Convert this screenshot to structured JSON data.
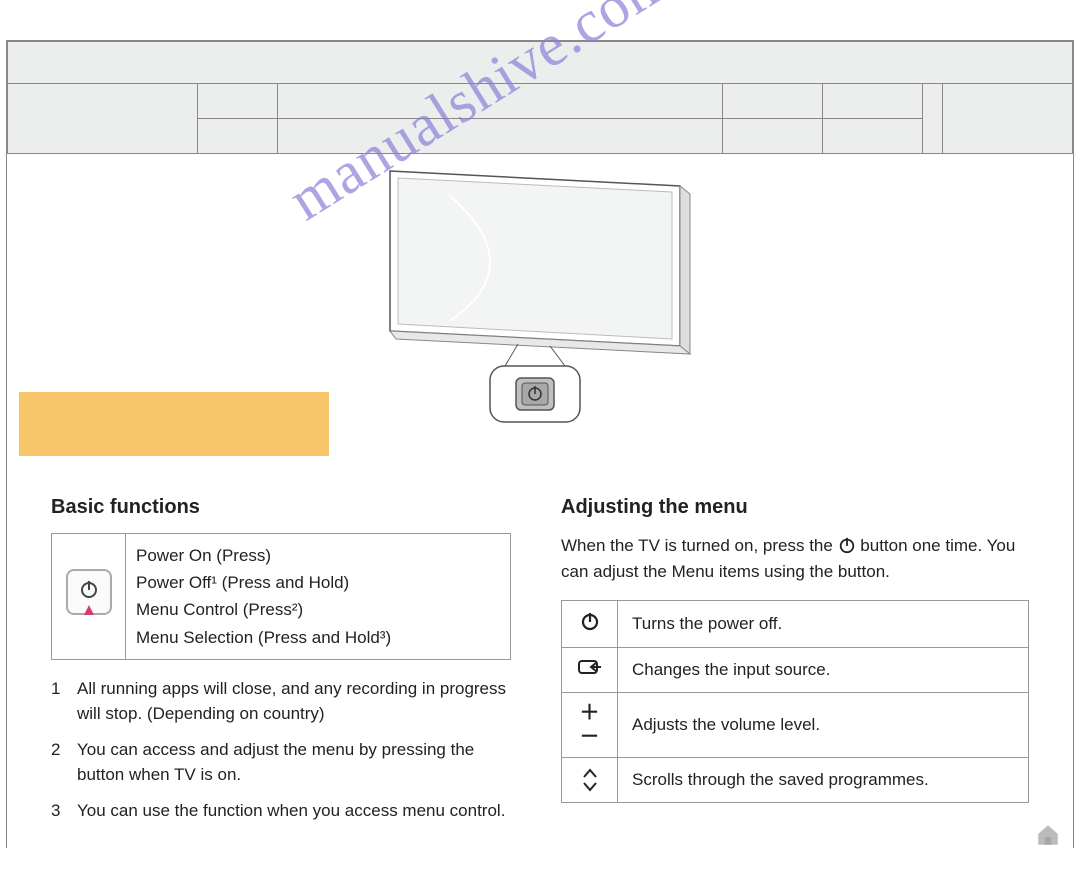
{
  "watermark": "manualshive.com",
  "basic_functions": {
    "heading": "Basic functions",
    "lines": [
      "Power On (Press)",
      "Power Off¹ (Press and Hold)",
      "Menu Control (Press²)",
      "Menu Selection (Press and Hold³)"
    ],
    "notes": [
      {
        "n": "1",
        "text": "All running apps will close, and any recording in progress will stop. (Depending on country)"
      },
      {
        "n": "2",
        "text": "You can access and adjust the menu by pressing the button when TV is on."
      },
      {
        "n": "3",
        "text": "You can use the function when you access menu control."
      }
    ]
  },
  "adjusting_menu": {
    "heading": "Adjusting the menu",
    "intro_pre": "When the TV is turned on, press the ",
    "intro_post": " button one time. You can adjust the Menu items using the button.",
    "rows": [
      {
        "sym": "power",
        "text": "Turns the power off."
      },
      {
        "sym": "input",
        "text": "Changes the input source."
      },
      {
        "sym": "plusminus",
        "text": "Adjusts the volume level."
      },
      {
        "sym": "updown",
        "text": "Scrolls through the saved programmes."
      }
    ]
  }
}
